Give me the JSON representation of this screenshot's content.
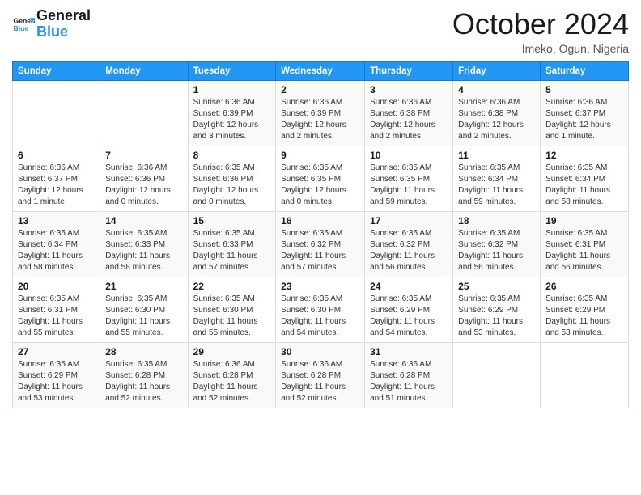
{
  "header": {
    "logo_line1": "General",
    "logo_line2": "Blue",
    "month": "October 2024",
    "location": "Imeko, Ogun, Nigeria"
  },
  "weekdays": [
    "Sunday",
    "Monday",
    "Tuesday",
    "Wednesday",
    "Thursday",
    "Friday",
    "Saturday"
  ],
  "weeks": [
    [
      {
        "day": null,
        "info": null
      },
      {
        "day": null,
        "info": null
      },
      {
        "day": "1",
        "info": "Sunrise: 6:36 AM\nSunset: 6:39 PM\nDaylight: 12 hours and 3 minutes."
      },
      {
        "day": "2",
        "info": "Sunrise: 6:36 AM\nSunset: 6:39 PM\nDaylight: 12 hours and 2 minutes."
      },
      {
        "day": "3",
        "info": "Sunrise: 6:36 AM\nSunset: 6:38 PM\nDaylight: 12 hours and 2 minutes."
      },
      {
        "day": "4",
        "info": "Sunrise: 6:36 AM\nSunset: 6:38 PM\nDaylight: 12 hours and 2 minutes."
      },
      {
        "day": "5",
        "info": "Sunrise: 6:36 AM\nSunset: 6:37 PM\nDaylight: 12 hours and 1 minute."
      }
    ],
    [
      {
        "day": "6",
        "info": "Sunrise: 6:36 AM\nSunset: 6:37 PM\nDaylight: 12 hours and 1 minute."
      },
      {
        "day": "7",
        "info": "Sunrise: 6:36 AM\nSunset: 6:36 PM\nDaylight: 12 hours and 0 minutes."
      },
      {
        "day": "8",
        "info": "Sunrise: 6:35 AM\nSunset: 6:36 PM\nDaylight: 12 hours and 0 minutes."
      },
      {
        "day": "9",
        "info": "Sunrise: 6:35 AM\nSunset: 6:35 PM\nDaylight: 12 hours and 0 minutes."
      },
      {
        "day": "10",
        "info": "Sunrise: 6:35 AM\nSunset: 6:35 PM\nDaylight: 11 hours and 59 minutes."
      },
      {
        "day": "11",
        "info": "Sunrise: 6:35 AM\nSunset: 6:34 PM\nDaylight: 11 hours and 59 minutes."
      },
      {
        "day": "12",
        "info": "Sunrise: 6:35 AM\nSunset: 6:34 PM\nDaylight: 11 hours and 58 minutes."
      }
    ],
    [
      {
        "day": "13",
        "info": "Sunrise: 6:35 AM\nSunset: 6:34 PM\nDaylight: 11 hours and 58 minutes."
      },
      {
        "day": "14",
        "info": "Sunrise: 6:35 AM\nSunset: 6:33 PM\nDaylight: 11 hours and 58 minutes."
      },
      {
        "day": "15",
        "info": "Sunrise: 6:35 AM\nSunset: 6:33 PM\nDaylight: 11 hours and 57 minutes."
      },
      {
        "day": "16",
        "info": "Sunrise: 6:35 AM\nSunset: 6:32 PM\nDaylight: 11 hours and 57 minutes."
      },
      {
        "day": "17",
        "info": "Sunrise: 6:35 AM\nSunset: 6:32 PM\nDaylight: 11 hours and 56 minutes."
      },
      {
        "day": "18",
        "info": "Sunrise: 6:35 AM\nSunset: 6:32 PM\nDaylight: 11 hours and 56 minutes."
      },
      {
        "day": "19",
        "info": "Sunrise: 6:35 AM\nSunset: 6:31 PM\nDaylight: 11 hours and 56 minutes."
      }
    ],
    [
      {
        "day": "20",
        "info": "Sunrise: 6:35 AM\nSunset: 6:31 PM\nDaylight: 11 hours and 55 minutes."
      },
      {
        "day": "21",
        "info": "Sunrise: 6:35 AM\nSunset: 6:30 PM\nDaylight: 11 hours and 55 minutes."
      },
      {
        "day": "22",
        "info": "Sunrise: 6:35 AM\nSunset: 6:30 PM\nDaylight: 11 hours and 55 minutes."
      },
      {
        "day": "23",
        "info": "Sunrise: 6:35 AM\nSunset: 6:30 PM\nDaylight: 11 hours and 54 minutes."
      },
      {
        "day": "24",
        "info": "Sunrise: 6:35 AM\nSunset: 6:29 PM\nDaylight: 11 hours and 54 minutes."
      },
      {
        "day": "25",
        "info": "Sunrise: 6:35 AM\nSunset: 6:29 PM\nDaylight: 11 hours and 53 minutes."
      },
      {
        "day": "26",
        "info": "Sunrise: 6:35 AM\nSunset: 6:29 PM\nDaylight: 11 hours and 53 minutes."
      }
    ],
    [
      {
        "day": "27",
        "info": "Sunrise: 6:35 AM\nSunset: 6:29 PM\nDaylight: 11 hours and 53 minutes."
      },
      {
        "day": "28",
        "info": "Sunrise: 6:35 AM\nSunset: 6:28 PM\nDaylight: 11 hours and 52 minutes."
      },
      {
        "day": "29",
        "info": "Sunrise: 6:36 AM\nSunset: 6:28 PM\nDaylight: 11 hours and 52 minutes."
      },
      {
        "day": "30",
        "info": "Sunrise: 6:36 AM\nSunset: 6:28 PM\nDaylight: 11 hours and 52 minutes."
      },
      {
        "day": "31",
        "info": "Sunrise: 6:36 AM\nSunset: 6:28 PM\nDaylight: 11 hours and 51 minutes."
      },
      {
        "day": null,
        "info": null
      },
      {
        "day": null,
        "info": null
      }
    ]
  ]
}
